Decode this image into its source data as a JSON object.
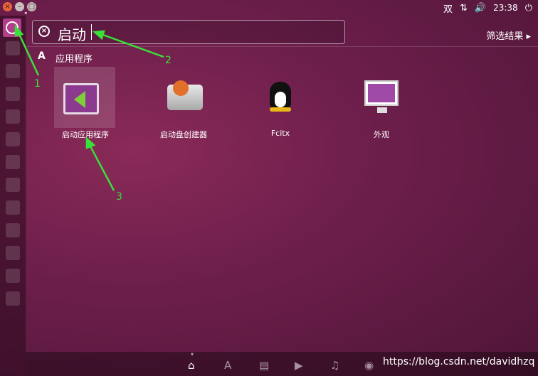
{
  "window_buttons": {
    "close": "×",
    "minimize": "–",
    "maximize": "□"
  },
  "tray": {
    "input_method": "双",
    "network_icon": "⇅",
    "volume_icon": "🔊",
    "time": "23:38",
    "power_icon": "⏻"
  },
  "search": {
    "query": "启动",
    "clear_icon": "×"
  },
  "filter": {
    "label": "筛选结果 ▸"
  },
  "category": {
    "icon": "A",
    "label": "应用程序"
  },
  "apps": [
    {
      "label": "启动应用程序"
    },
    {
      "label": "启动盘创建器"
    },
    {
      "label": "Fcitx"
    },
    {
      "label": "外观"
    }
  ],
  "annotations": [
    "1",
    "2",
    "3"
  ],
  "lenses": {
    "home": "⌂",
    "apps": "A",
    "files": "▤",
    "video": "▶",
    "music": "♫",
    "photo": "◉"
  },
  "lens_marker": "▾",
  "watermark": "https://blog.csdn.net/davidhzq"
}
